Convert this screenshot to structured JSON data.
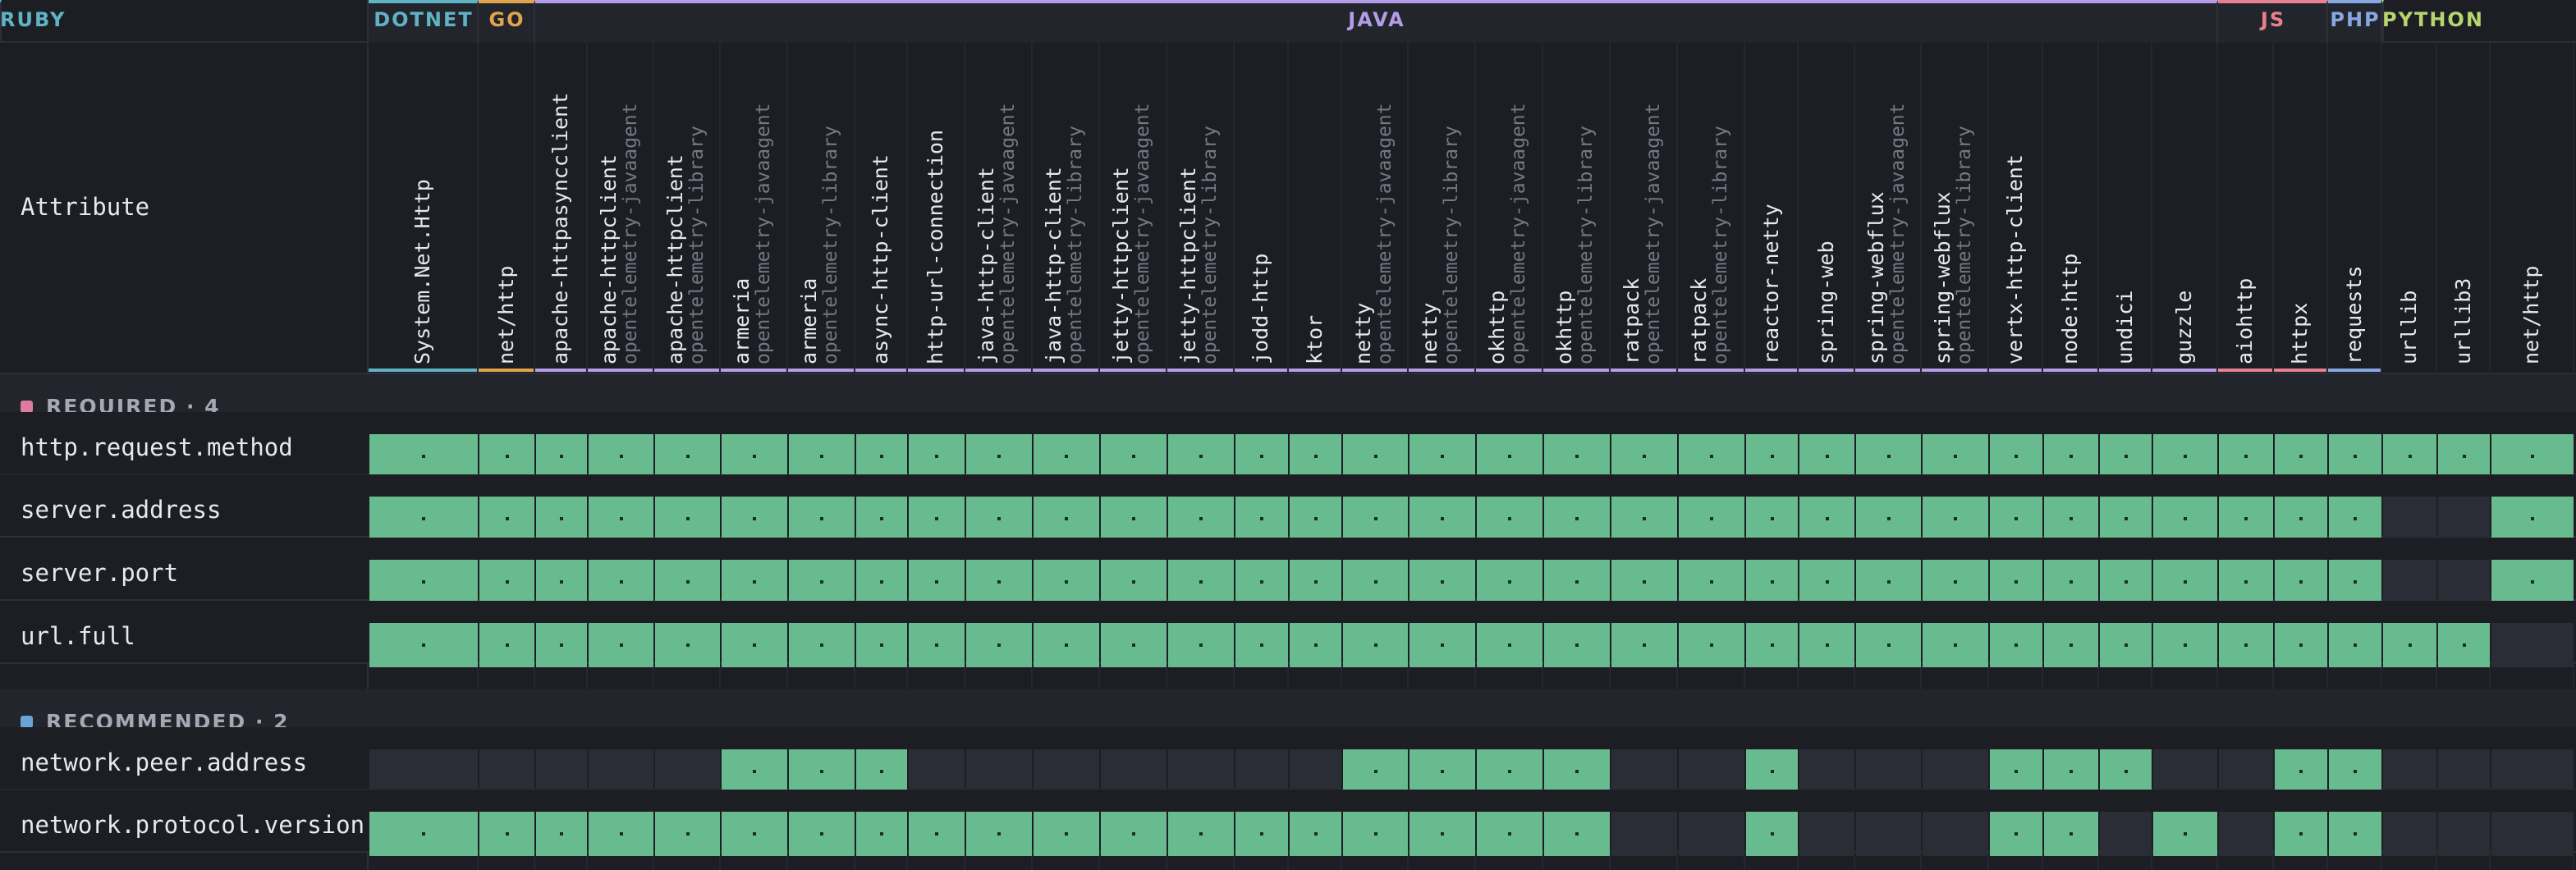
{
  "header": {
    "attribute_label": "Attribute"
  },
  "colors": {
    "dotnet": "#5fb3c4",
    "go": "#e0a34e",
    "java": "#b59ce8",
    "js": "#e8818f",
    "php": "#86a8e0",
    "python": "#b7d46f",
    "ruby": "#5fb3c4",
    "supported": "#68bb8e",
    "unsupported": "#2a2d35",
    "required": "#e07a9e",
    "recommended": "#6ba3d8"
  },
  "languages": [
    {
      "name": "DOTNET",
      "key": "dotnet",
      "count": 1
    },
    {
      "name": "GO",
      "key": "go",
      "count": 1
    },
    {
      "name": "JAVA",
      "key": "java",
      "count": 27
    },
    {
      "name": "JS",
      "key": "js",
      "count": 2
    },
    {
      "name": "PHP",
      "key": "php",
      "count": 1
    },
    {
      "name": "PYTHON",
      "key": "python",
      "count": 5
    },
    {
      "name": "RUBY",
      "key": "ruby",
      "count": 1
    }
  ],
  "libraries": [
    {
      "name": "System.Net.Http",
      "variant": ""
    },
    {
      "name": "net/http",
      "variant": ""
    },
    {
      "name": "apache-httpasyncclient",
      "variant": ""
    },
    {
      "name": "apache-httpclient",
      "variant": "opentelemetry-javaagent"
    },
    {
      "name": "apache-httpclient",
      "variant": "opentelemetry-library"
    },
    {
      "name": "armeria",
      "variant": "opentelemetry-javaagent"
    },
    {
      "name": "armeria",
      "variant": "opentelemetry-library"
    },
    {
      "name": "async-http-client",
      "variant": ""
    },
    {
      "name": "http-url-connection",
      "variant": ""
    },
    {
      "name": "java-http-client",
      "variant": "opentelemetry-javaagent"
    },
    {
      "name": "java-http-client",
      "variant": "opentelemetry-library"
    },
    {
      "name": "jetty-httpclient",
      "variant": "opentelemetry-javaagent"
    },
    {
      "name": "jetty-httpclient",
      "variant": "opentelemetry-library"
    },
    {
      "name": "jodd-http",
      "variant": ""
    },
    {
      "name": "ktor",
      "variant": ""
    },
    {
      "name": "netty",
      "variant": "opentelemetry-javaagent"
    },
    {
      "name": "netty",
      "variant": "opentelemetry-library"
    },
    {
      "name": "okhttp",
      "variant": "opentelemetry-javaagent"
    },
    {
      "name": "okhttp",
      "variant": "opentelemetry-library"
    },
    {
      "name": "ratpack",
      "variant": "opentelemetry-javaagent"
    },
    {
      "name": "ratpack",
      "variant": "opentelemetry-library"
    },
    {
      "name": "reactor-netty",
      "variant": ""
    },
    {
      "name": "spring-web",
      "variant": ""
    },
    {
      "name": "spring-webflux",
      "variant": "opentelemetry-javaagent"
    },
    {
      "name": "spring-webflux",
      "variant": "opentelemetry-library"
    },
    {
      "name": "vertx-http-client",
      "variant": ""
    },
    {
      "name": "node:http",
      "variant": ""
    },
    {
      "name": "undici",
      "variant": ""
    },
    {
      "name": "guzzle",
      "variant": ""
    },
    {
      "name": "aiohttp",
      "variant": ""
    },
    {
      "name": "httpx",
      "variant": ""
    },
    {
      "name": "requests",
      "variant": ""
    },
    {
      "name": "urllib",
      "variant": ""
    },
    {
      "name": "urllib3",
      "variant": ""
    },
    {
      "name": "net/http",
      "variant": ""
    }
  ],
  "sections": [
    {
      "label": "REQUIRED · 4",
      "color_key": "required",
      "rows": [
        {
          "attribute": "http.request.method",
          "support": [
            1,
            1,
            1,
            1,
            1,
            1,
            1,
            1,
            1,
            1,
            1,
            1,
            1,
            1,
            1,
            1,
            1,
            1,
            1,
            1,
            1,
            1,
            1,
            1,
            1,
            1,
            1,
            1,
            1,
            1,
            1,
            1,
            1,
            1,
            1
          ]
        },
        {
          "attribute": "server.address",
          "support": [
            1,
            1,
            1,
            1,
            1,
            1,
            1,
            1,
            1,
            1,
            1,
            1,
            1,
            1,
            1,
            1,
            1,
            1,
            1,
            1,
            1,
            1,
            1,
            1,
            1,
            1,
            1,
            1,
            1,
            1,
            1,
            1,
            0,
            0,
            1
          ]
        },
        {
          "attribute": "server.port",
          "support": [
            1,
            1,
            1,
            1,
            1,
            1,
            1,
            1,
            1,
            1,
            1,
            1,
            1,
            1,
            1,
            1,
            1,
            1,
            1,
            1,
            1,
            1,
            1,
            1,
            1,
            1,
            1,
            1,
            1,
            1,
            1,
            1,
            0,
            0,
            1
          ]
        },
        {
          "attribute": "url.full",
          "support": [
            1,
            1,
            1,
            1,
            1,
            1,
            1,
            1,
            1,
            1,
            1,
            1,
            1,
            1,
            1,
            1,
            1,
            1,
            1,
            1,
            1,
            1,
            1,
            1,
            1,
            1,
            1,
            1,
            1,
            1,
            1,
            1,
            1,
            1,
            0
          ]
        }
      ]
    },
    {
      "label": "RECOMMENDED · 2",
      "color_key": "recommended",
      "rows": [
        {
          "attribute": "network.peer.address",
          "support": [
            0,
            0,
            0,
            0,
            0,
            1,
            1,
            1,
            0,
            0,
            0,
            0,
            0,
            0,
            0,
            1,
            1,
            1,
            1,
            0,
            0,
            1,
            0,
            0,
            0,
            1,
            1,
            1,
            0,
            0,
            1,
            1,
            0,
            0,
            0
          ]
        },
        {
          "attribute": "network.protocol.version",
          "support": [
            1,
            1,
            1,
            1,
            1,
            1,
            1,
            1,
            1,
            1,
            1,
            1,
            1,
            1,
            1,
            1,
            1,
            1,
            1,
            0,
            0,
            1,
            0,
            0,
            0,
            1,
            1,
            0,
            1,
            0,
            1,
            1,
            0,
            0,
            0
          ]
        }
      ]
    }
  ]
}
